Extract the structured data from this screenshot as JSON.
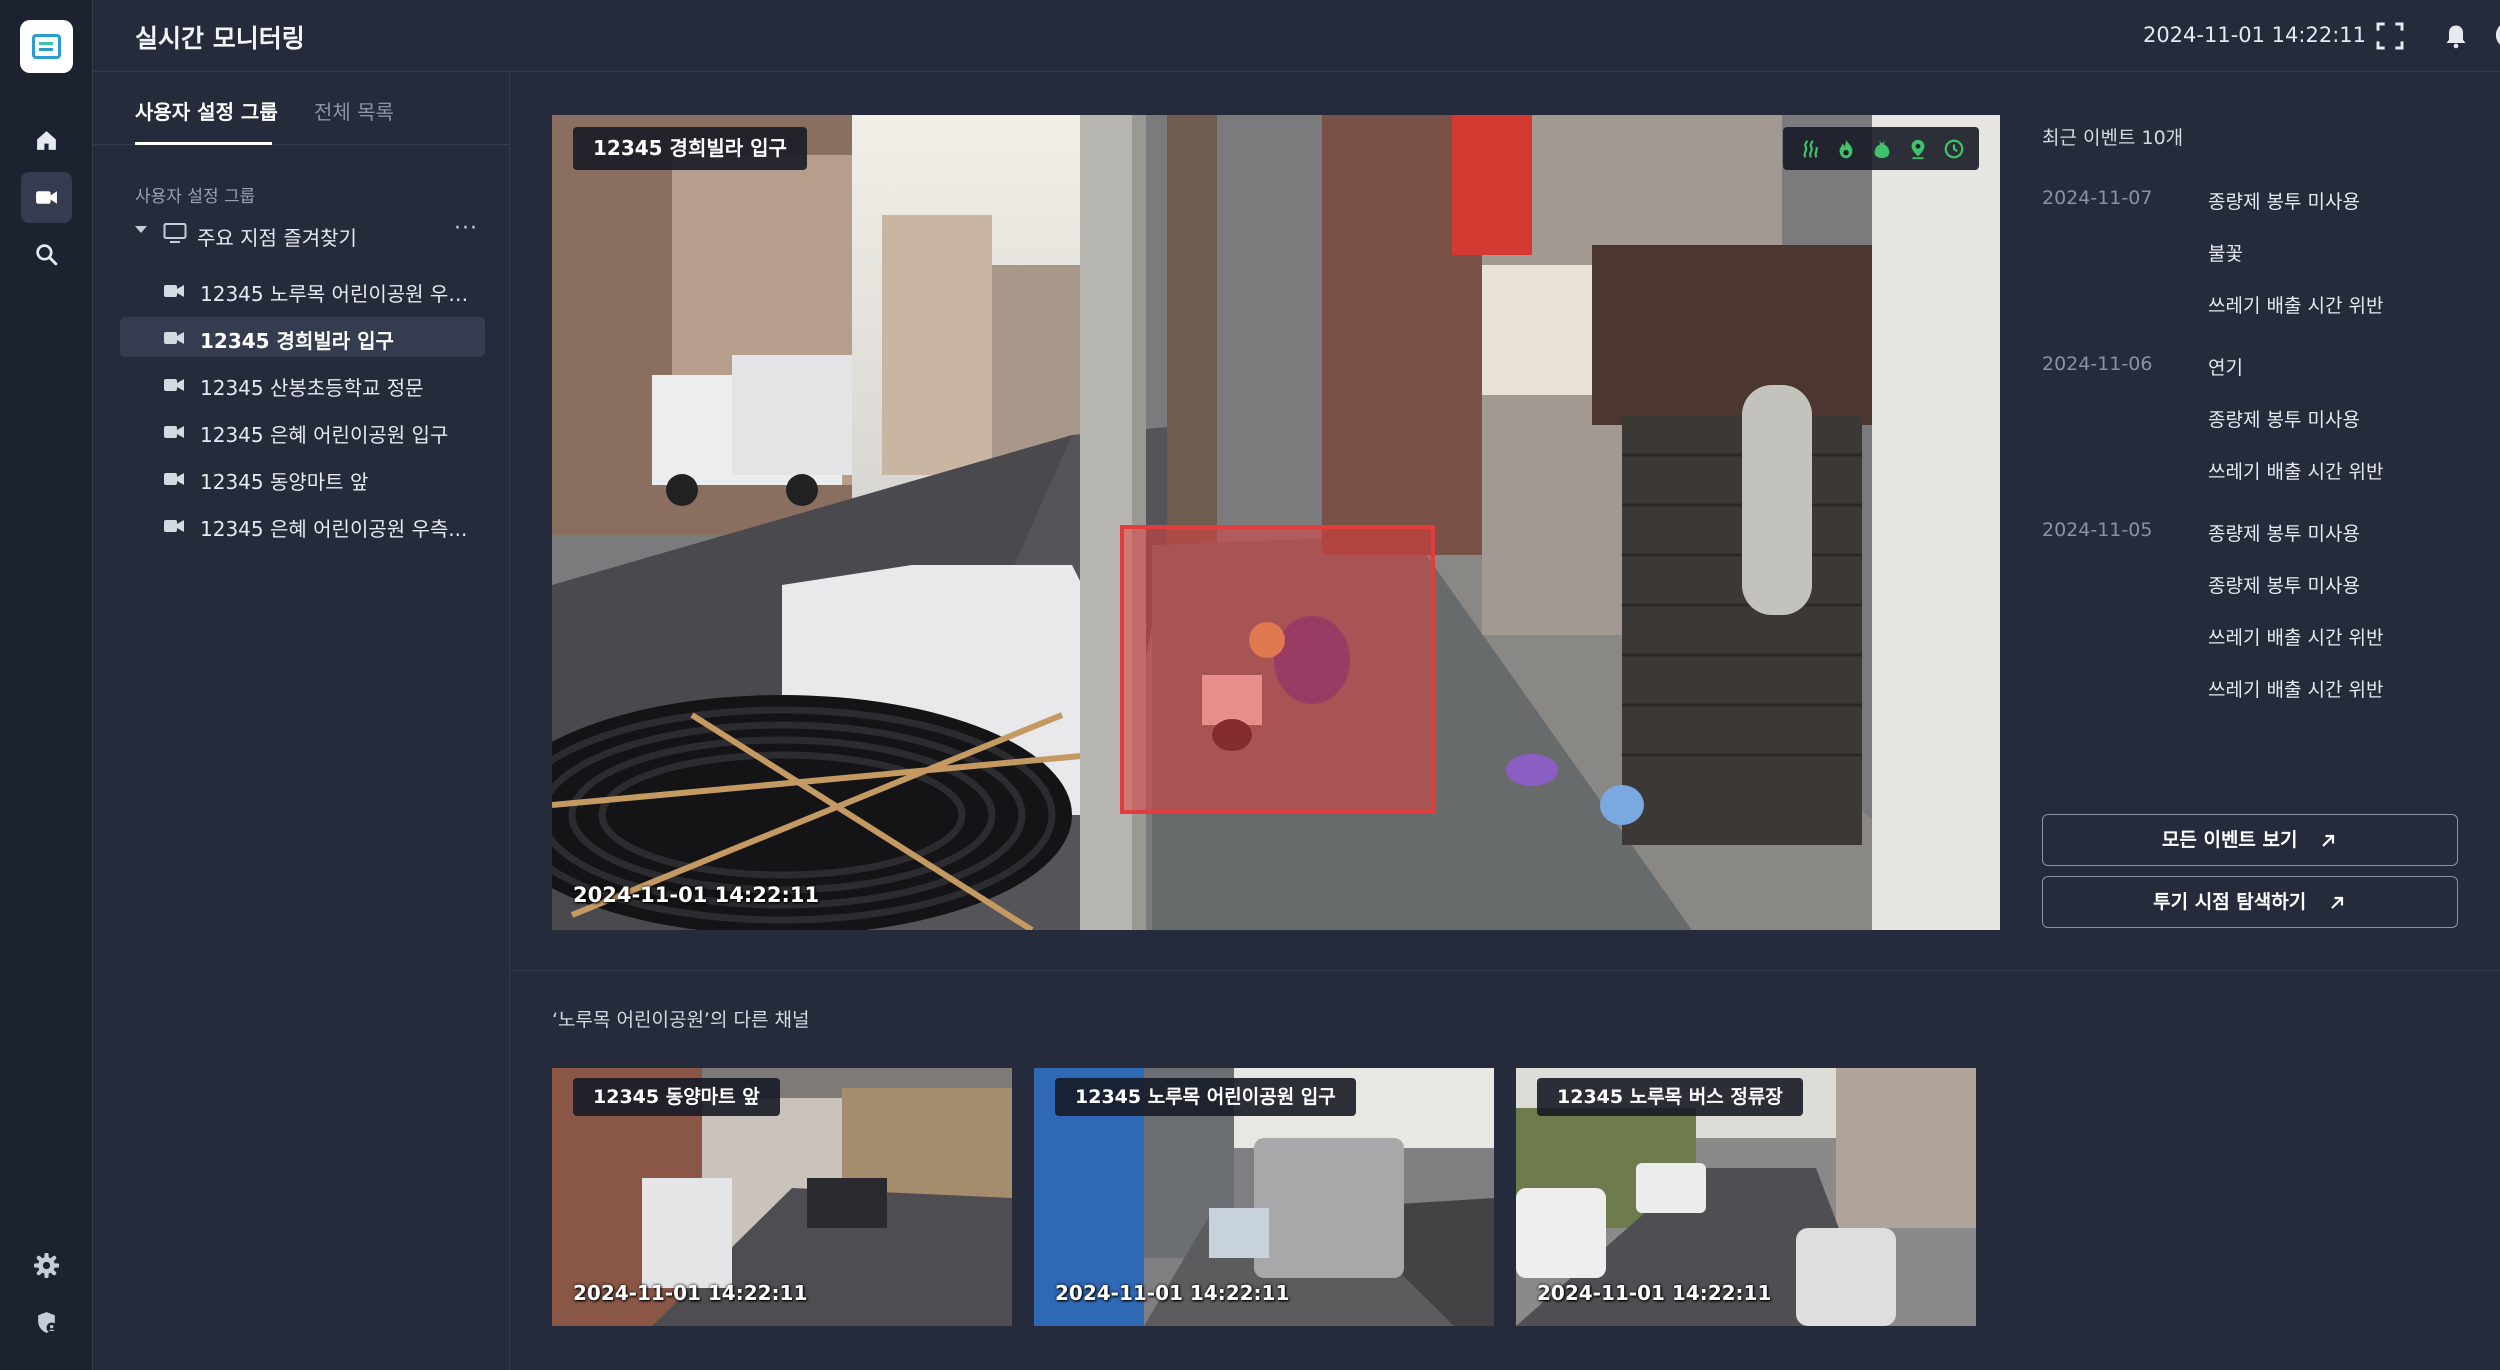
{
  "app": {
    "page_title": "실시간 모니터링",
    "clock": "2024-11-01 14:22:11"
  },
  "rail": {
    "icons": [
      "home-icon",
      "camera-icon",
      "search-icon",
      "settings-icon",
      "shield-user-icon"
    ],
    "active": "camera-icon"
  },
  "sidebar": {
    "tabs": [
      {
        "label": "사용자 설정 그룹",
        "active": true
      },
      {
        "label": "전체 목록",
        "active": false
      }
    ],
    "group_label": "사용자 설정 그룹",
    "group": {
      "label": "주요 지점 즐겨찾기",
      "more": "···"
    },
    "items": [
      {
        "label": "12345 노루목 어린이공원 우측..."
      },
      {
        "label": "12345 경희빌라 입구"
      },
      {
        "label": "12345 산봉초등학교 정문"
      },
      {
        "label": "12345 은혜 어린이공원 입구"
      },
      {
        "label": "12345 동양마트 앞"
      },
      {
        "label": "12345 은혜 어린이공원 우측..."
      }
    ],
    "active_index": 1
  },
  "main_video": {
    "title": "12345 경희빌라 입구",
    "timestamp": "2024-11-01 14:22:11",
    "detection_icons": [
      "smoke-icon",
      "fire-icon",
      "trash-bag-icon",
      "location-pin-icon",
      "clock-icon"
    ],
    "detection_color": "#3fc26b",
    "alert_color": "#e23d3d"
  },
  "events": {
    "title": "최근 이벤트 10개",
    "groups": [
      {
        "date": "2024-11-07",
        "items": [
          "종량제 봉투 미사용",
          "불꽃",
          "쓰레기 배출 시간 위반"
        ]
      },
      {
        "date": "2024-11-06",
        "items": [
          "연기",
          "종량제 봉투 미사용",
          "쓰레기 배출 시간 위반"
        ]
      },
      {
        "date": "2024-11-05",
        "items": [
          "종량제 봉투 미사용",
          "종량제 봉투 미사용",
          "쓰레기 배출 시간 위반",
          "쓰레기 배출 시간 위반"
        ]
      }
    ],
    "buttons": {
      "all_events": "모든 이벤트 보기",
      "explore_dump": "투기 시점 탐색하기"
    }
  },
  "other_channels": {
    "title": "‘노루목 어린이공원’의 다른 채널",
    "thumbs": [
      {
        "title": "12345 동양마트 앞",
        "timestamp": "2024-11-01 14:22:11"
      },
      {
        "title": "12345 노루목 어린이공원 입구",
        "timestamp": "2024-11-01 14:22:11"
      },
      {
        "title": "12345 노루목 버스 정류장",
        "timestamp": "2024-11-01 14:22:11"
      }
    ]
  }
}
